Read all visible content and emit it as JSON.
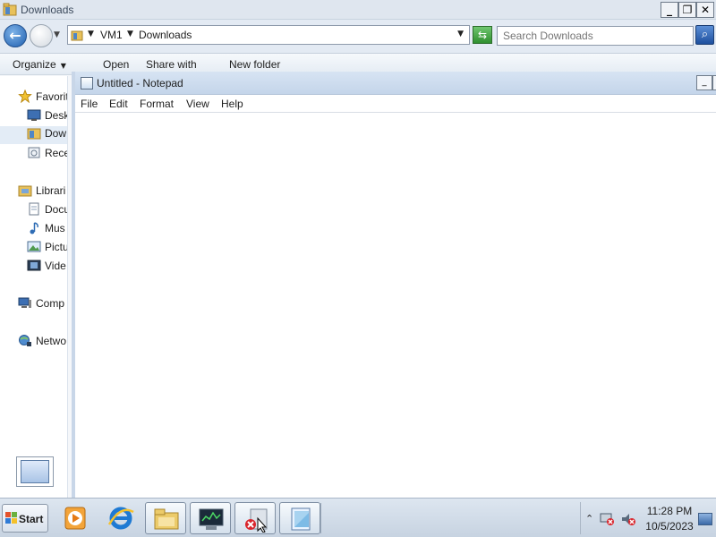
{
  "explorer": {
    "title": "Downloads",
    "breadcrumb": [
      "VM1",
      "Downloads"
    ],
    "search_placeholder": "Search Downloads",
    "toolbar": {
      "organize": "Organize",
      "open": "Open",
      "share_with": "Share with",
      "new_folder": "New folder"
    },
    "nav": {
      "favorites": "Favorit",
      "desktop": "Desk",
      "downloads": "Dow",
      "recent": "Rece",
      "libraries": "Librari",
      "documents": "Docu",
      "music": "Mus",
      "pictures": "Pictu",
      "videos": "Vide",
      "computer": "Comp",
      "network": "Netwo"
    }
  },
  "notepad": {
    "title": "Untitled - Notepad",
    "menu": [
      "File",
      "Edit",
      "Format",
      "View",
      "Help"
    ],
    "content": ""
  },
  "taskbar": {
    "start_label": "Start",
    "pinned": [
      "media-player-icon",
      "internet-explorer-icon",
      "file-explorer-icon",
      "terminal-icon",
      "error-app-icon",
      "notepad-icon"
    ],
    "clock": {
      "time": "11:28 PM",
      "date": "10/5/2023"
    }
  },
  "colors": {
    "accent": "#1e5fb0",
    "titlebar": "#dfe6ef",
    "taskbar": "#c7d3e1"
  }
}
